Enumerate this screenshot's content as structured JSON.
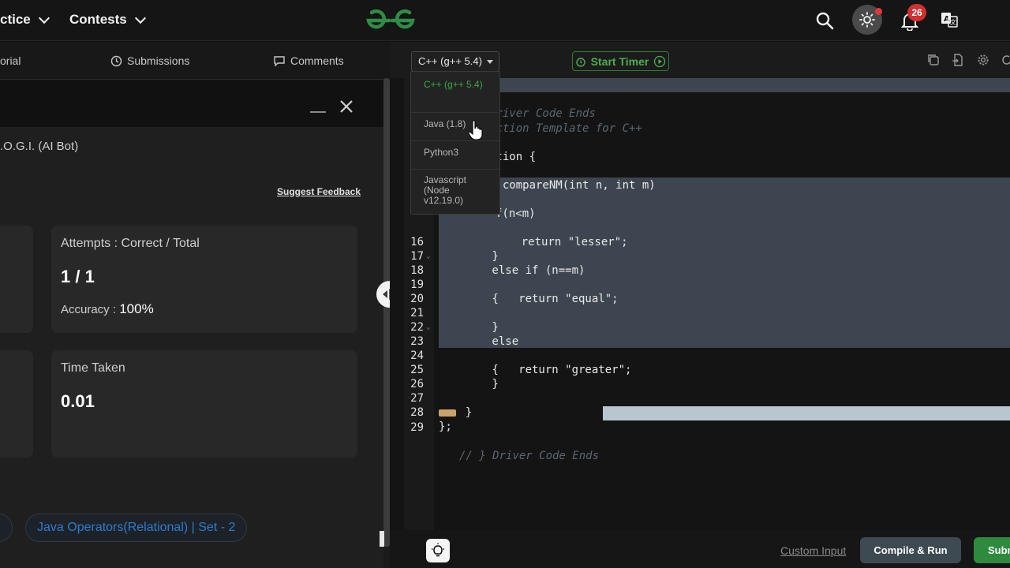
{
  "nav": {
    "practice_label": "ctice",
    "contests_label": "Contests",
    "notifications_count": "26"
  },
  "left_panel": {
    "tabs": [
      {
        "label": "orial"
      },
      {
        "label": "Submissions"
      },
      {
        "label": "Comments"
      }
    ],
    "bot_label": ".O.G.I. (AI Bot)",
    "suggest_feedback": "Suggest Feedback",
    "attempts_card": {
      "title": "Attempts : Correct / Total",
      "value": "1 / 1",
      "accuracy_label": "Accuracy :",
      "accuracy_value": "100%"
    },
    "time_card": {
      "title": "Time Taken",
      "value": "0.01"
    },
    "topic_tag": "Java Operators(Relational) | Set - 2"
  },
  "editor": {
    "language_selected": "C++ (g++ 5.4)",
    "start_timer": "Start Timer",
    "language_options": [
      {
        "label": "C++ (g++ 5.4)"
      },
      {
        "label": "Java (1.8)"
      },
      {
        "label": "Python3"
      },
      {
        "label": "Javascript (Node v12.19.0)"
      }
    ],
    "lines": [
      {
        "n": "",
        "text": "Driver Code Ends",
        "kind": "comment"
      },
      {
        "n": "",
        "text": "nction Template for C++",
        "kind": "comment"
      },
      {
        "n": "",
        "text": "ution {",
        "kind": "code"
      },
      {
        "n": "",
        "text": "g compareNM(int n, int m)",
        "kind": "code"
      },
      {
        "n": "",
        "text": "f(n<m)",
        "kind": "code"
      },
      {
        "n": "",
        "text": "    return \"lesser\";",
        "kind": "code"
      },
      {
        "n": "16",
        "text": "        }",
        "kind": "code"
      },
      {
        "n": "17",
        "text": "        else if (n==m)",
        "kind": "code"
      },
      {
        "n": "18",
        "text": "        {",
        "kind": "code"
      },
      {
        "n": "19",
        "text": "            return \"equal\";",
        "kind": "code"
      },
      {
        "n": "20",
        "text": "",
        "kind": "code"
      },
      {
        "n": "21",
        "text": "        }",
        "kind": "code"
      },
      {
        "n": "22",
        "text": "        else",
        "kind": "code"
      },
      {
        "n": "23",
        "text": "        {",
        "kind": "code"
      },
      {
        "n": "24",
        "text": "            return \"greater\";",
        "kind": "code"
      },
      {
        "n": "25",
        "text": "        }",
        "kind": "code"
      },
      {
        "n": "26",
        "text": "",
        "kind": "code"
      },
      {
        "n": "27",
        "text": "    }",
        "kind": "code"
      },
      {
        "n": "28",
        "text": "};",
        "kind": "code"
      },
      {
        "n": "29",
        "text": "// } Driver Code Ends",
        "kind": "comment"
      }
    ]
  },
  "bottom": {
    "custom_input": "Custom Input",
    "compile_run": "Compile & Run",
    "submit": "Submit"
  }
}
